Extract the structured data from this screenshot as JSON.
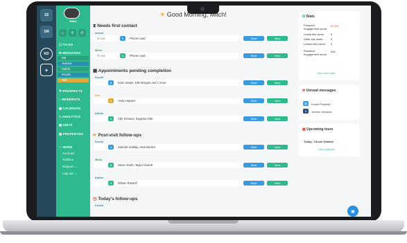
{
  "rail": {
    "items": [
      "1S",
      "1W",
      "KD",
      "+"
    ]
  },
  "sidebar": {
    "user": "Mitch",
    "nav": [
      "TO-DO",
      "MESSAGES",
      "PROSPECTS",
      "RESIDENTS",
      "CALENDAR",
      "ANALYTICS",
      "UNITS",
      "PROPERTIES",
      "MORE",
      "Account",
      "Toolbox",
      "Support",
      "Log out"
    ],
    "msg_subs": [
      "Me",
      "Jenece",
      "Kalvin",
      "Knock",
      "Tab"
    ]
  },
  "greeting": "Good Morning, Mitch!",
  "sections": {
    "s1": "Needs first contact",
    "s2": "Appointments pending completion",
    "s3": "Post-visit follow-ups",
    "s4": "Today's follow-ups"
  },
  "groups": [
    "Knock",
    "Mitch",
    "Knock",
    "Zoe",
    "Kalvin",
    "Knock",
    "Mitch",
    "Kalvin",
    "Knock"
  ],
  "rows": [
    {
      "icon": "Cell",
      "badge": "1",
      "name": "Phone Lead"
    },
    {
      "icon": "Cell",
      "badge": "1",
      "name": "Phone Lead"
    },
    {
      "badge": "3",
      "name": "Evan Sespe, Elle Morgan and 1 more"
    },
    {
      "badge": "1",
      "name": "Andy Hayden"
    },
    {
      "badge": "1",
      "name": "Abe Schuetz, Eugenia Tate"
    },
    {
      "badge": "1",
      "name": "Zannah Holiday, Jack Becker"
    },
    {
      "badge": "2",
      "name": "Steve Smith, Taylor Garrett"
    },
    {
      "badge": "1",
      "name": "Wilson Russell"
    }
  ],
  "buttons": {
    "start": "Start",
    "view": "View"
  },
  "stats": {
    "title": "Stats",
    "items": [
      {
        "label": "Prospect engagement score:",
        "value": "87.6%"
      },
      {
        "label": "Leads this week:",
        "value": "5"
      },
      {
        "label": "Visits this week:",
        "value": "5"
      },
      {
        "label": "Leases this week:",
        "value": "0"
      },
      {
        "label": "Resident engagement score:",
        "value": "N/A"
      }
    ],
    "link": "View more data"
  },
  "unread": {
    "title": "Unread messages",
    "items": [
      {
        "count": "20",
        "name": "Knock Property"
      },
      {
        "count": "1",
        "name": "Jenece Johnson"
      }
    ]
  },
  "tours": {
    "title": "Upcoming tours",
    "item": "Today - Chuck Gamble",
    "link": "View calendar"
  },
  "colors": {
    "green": "#2fb98e",
    "blue": "#3a9be0",
    "rail": "#264a5c",
    "red": "#e0452f"
  }
}
